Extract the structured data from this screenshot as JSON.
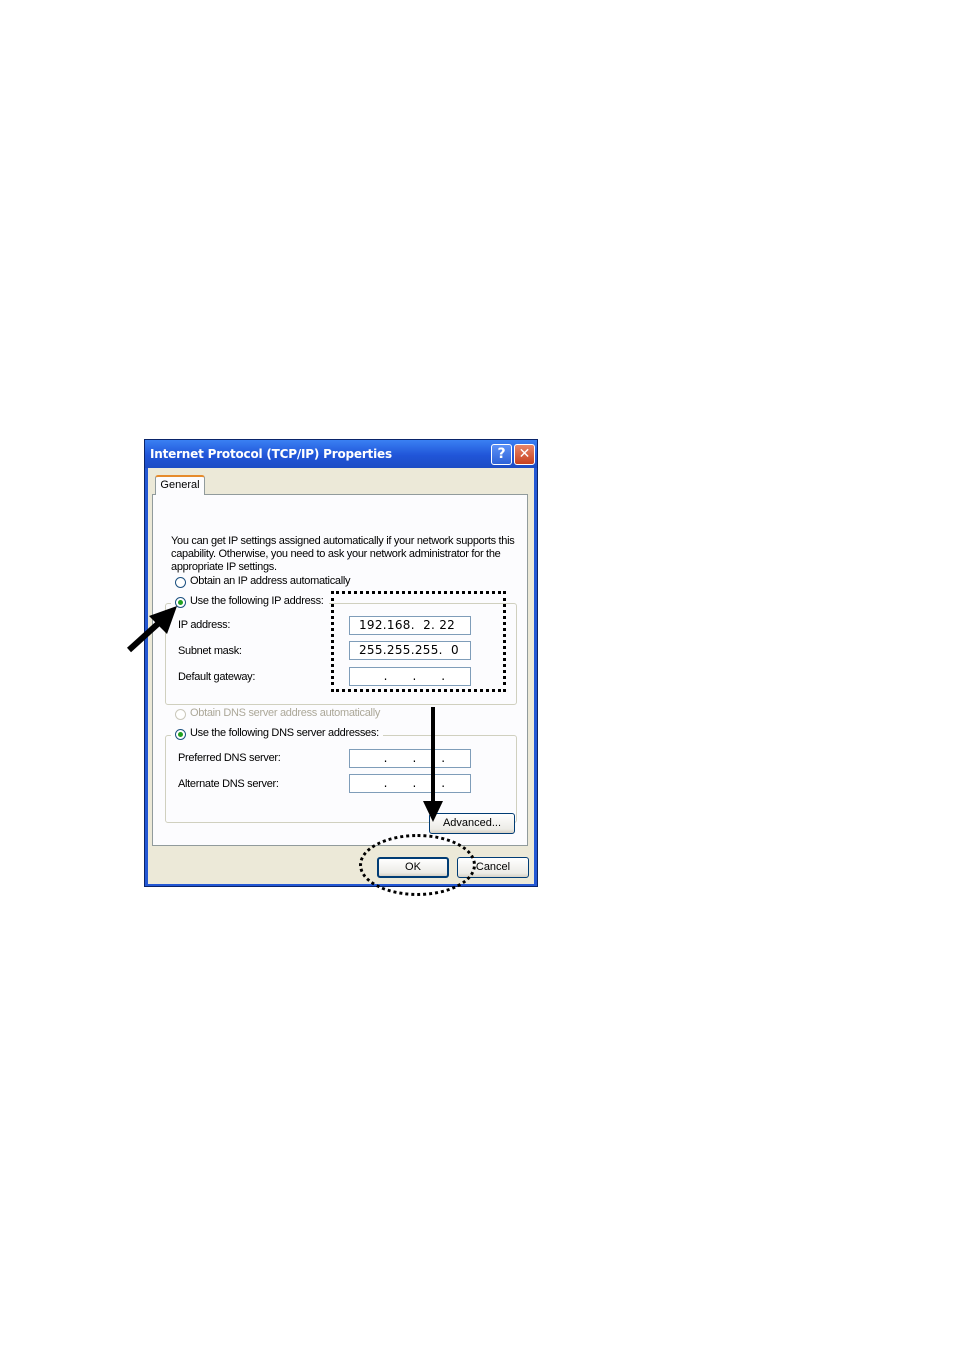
{
  "window": {
    "title": "Internet Protocol (TCP/IP) Properties",
    "help_label": "?",
    "close_label": "✕"
  },
  "tabs": [
    {
      "label": "General",
      "selected": true
    }
  ],
  "intro": "You can get IP settings assigned automatically if your network supports this capability. Otherwise, you need to ask your network administrator for the appropriate IP settings.",
  "ip_options": {
    "auto": {
      "label": "Obtain an IP address automatically",
      "selected": false
    },
    "manual": {
      "label": "Use the following IP address:",
      "selected": true
    }
  },
  "ip_fields": {
    "ip_address": {
      "label": "IP address:",
      "value": "192.168.  2. 22"
    },
    "subnet_mask": {
      "label": "Subnet mask:",
      "value": "255.255.255.  0"
    },
    "default_gateway": {
      "label": "Default gateway:",
      "value": "      .      .      ."
    }
  },
  "dns_options": {
    "auto": {
      "label": "Obtain DNS server address automatically",
      "selected": false,
      "disabled": true
    },
    "manual": {
      "label": "Use the following DNS server addresses:",
      "selected": true
    }
  },
  "dns_fields": {
    "preferred": {
      "label": "Preferred DNS server:",
      "value": "      .      .      ."
    },
    "alternate": {
      "label": "Alternate DNS server:",
      "value": "      .      .      ."
    }
  },
  "buttons": {
    "advanced": "Advanced...",
    "ok": "OK",
    "cancel": "Cancel"
  },
  "colors": {
    "titlebar": "#2458d4",
    "dialog_bg": "#ece9d8",
    "radio_selected": "#21a121"
  }
}
